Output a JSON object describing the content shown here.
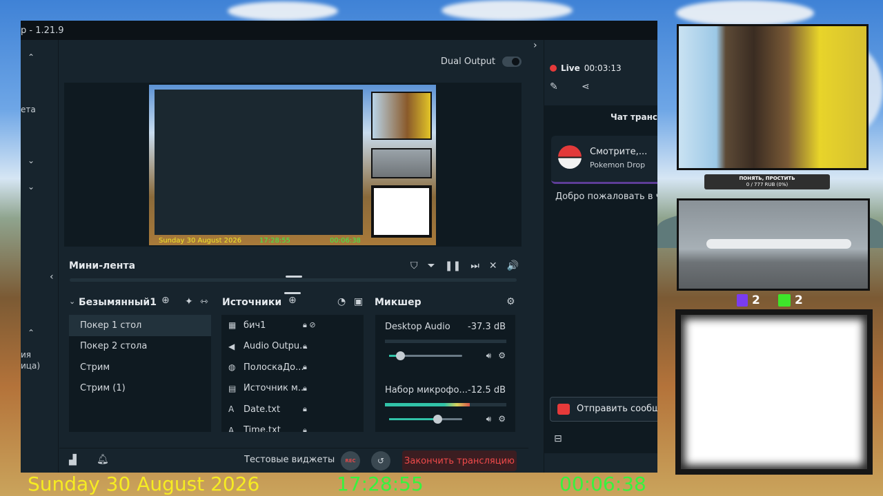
{
  "window": {
    "title": "p - 1.21.9"
  },
  "left_rail": {
    "items": [
      "ета",
      "ия",
      "ица)"
    ]
  },
  "header": {
    "dual_output_label": "Dual Output"
  },
  "preview": {
    "date": "Sunday 30 August 2026",
    "time": "17:28:55",
    "timer": "00:06:38"
  },
  "minifeed": {
    "label": "Мини-лента"
  },
  "scenes": {
    "collection_name": "Безымянный1",
    "items": [
      {
        "label": "Покер 1 стол",
        "active": true
      },
      {
        "label": "Покер 2 стола",
        "active": false
      },
      {
        "label": "Стрим",
        "active": false
      },
      {
        "label": "Стрим (1)",
        "active": false
      }
    ]
  },
  "sources": {
    "title": "Источники",
    "items": [
      {
        "label": "бич1",
        "icon": "image-icon"
      },
      {
        "label": "Audio Outpu...",
        "icon": "speaker-icon"
      },
      {
        "label": "ПолоскаДо...",
        "icon": "globe-icon"
      },
      {
        "label": "Источник м...",
        "icon": "file-icon"
      },
      {
        "label": "Date.txt",
        "icon": "text-icon"
      },
      {
        "label": "Time.txt",
        "icon": "text-icon"
      }
    ]
  },
  "mixer": {
    "title": "Микшер",
    "channels": [
      {
        "name": "Desktop Audio",
        "db": "-37.3 dB",
        "level": 0.0,
        "volume": 0.15
      },
      {
        "name": "Набор микрофо...",
        "db": "-12.5 dB",
        "level": 0.7,
        "volume": 0.67
      }
    ]
  },
  "bottom": {
    "test_widgets": "Тестовые виджеты",
    "rec": "REC",
    "end_stream": "Закончить трансляцию"
  },
  "live": {
    "status": "Live",
    "duration": "00:03:13"
  },
  "chat": {
    "title": "Чат трансл",
    "card_title": "Смотрите,...",
    "card_subtitle": "Pokemon Drop",
    "welcome": "Добро пожаловать в ч",
    "send": "Отправить сообщ"
  },
  "overlay": {
    "caption_line1": "ПОНЯТЬ, ПРОСТИТЬ",
    "caption_line2": "0 / 777 RUB (0%)",
    "twitch_count": "2",
    "kick_count": "2",
    "date": "Sunday 30 August 2026",
    "time": "17:28:55",
    "timer": "00:06:38"
  },
  "colors": {
    "date": "#f6ec22",
    "time": "#38f23e",
    "live_dot": "#e63a3a",
    "end_button": "#f04a4a",
    "meter": "#31c3a8"
  }
}
